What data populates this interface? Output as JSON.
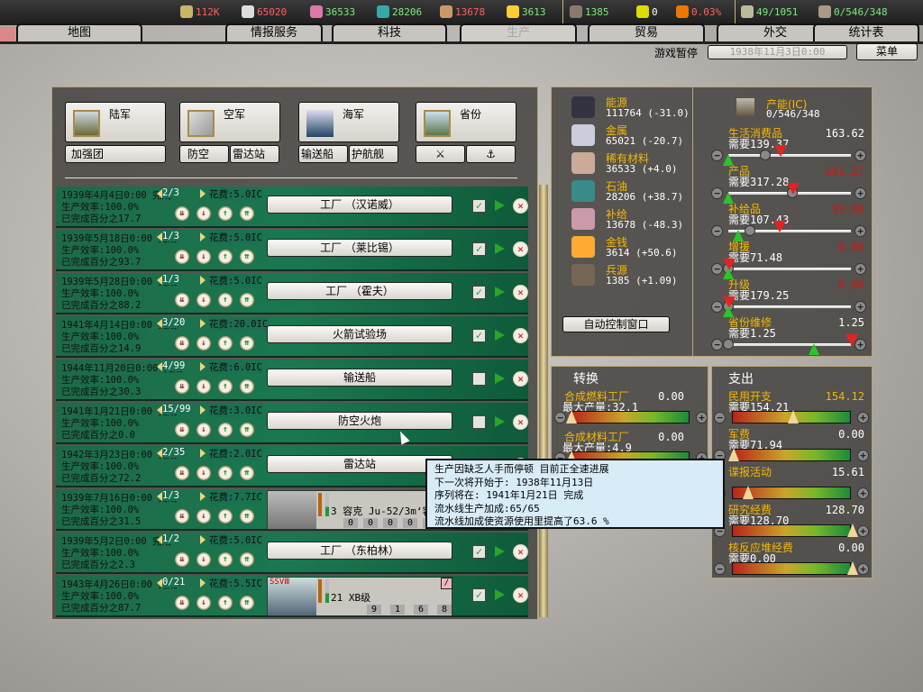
{
  "topbar": {
    "resources": [
      {
        "name": "energy",
        "value": "112K",
        "color": "#ff6060"
      },
      {
        "name": "metal",
        "value": "65020",
        "color": "#ff6060"
      },
      {
        "name": "rare",
        "value": "36533",
        "color": "#7de87d"
      },
      {
        "name": "oil",
        "value": "28206",
        "color": "#7de87d"
      },
      {
        "name": "supplies",
        "value": "13678",
        "color": "#ff6060"
      },
      {
        "name": "money",
        "value": "3613",
        "color": "#7de87d"
      }
    ],
    "manpower": "1385",
    "nuclear": "0",
    "dissent": "0.03%",
    "transports": "49/1051",
    "ic": "0/546/348"
  },
  "tabs": [
    "地图",
    "情报服务",
    "科技",
    "生产",
    "贸易",
    "外交",
    "统计表"
  ],
  "status": {
    "paused": "游戏暂停",
    "date": "1938年11月3日0:00",
    "menu": "菜单"
  },
  "categories": {
    "army": "陆军",
    "air": "空军",
    "navy": "海军",
    "province": "省份",
    "brigade": "加强团",
    "aa": "防空",
    "radar": "雷达站",
    "transport": "输送船",
    "escort": "护航舰",
    "fort_icon": "⚔",
    "port_icon": "⚓"
  },
  "queue": [
    {
      "date": "1939年4月4日0:00 完成",
      "count": "2/3",
      "cost": "花费:5.0IC",
      "eff": "生产效率:100.0%",
      "pct": "已完成百分之17.7",
      "name": "工厂  （汉诺威）",
      "checked": true
    },
    {
      "date": "1939年5月18日0:00 完成",
      "count": "1/3",
      "cost": "花费:5.0IC",
      "eff": "生产效率:100.0%",
      "pct": "已完成百分之93.7",
      "name": "工厂  （莱比锡）",
      "checked": true
    },
    {
      "date": "1939年5月28日0:00 完成",
      "count": "1/3",
      "cost": "花费:5.0IC",
      "eff": "生产效率:100.0%",
      "pct": "已完成百分之88.2",
      "name": "工厂  （霍夫）",
      "checked": true
    },
    {
      "date": "1941年4月14日0:00 完成",
      "count": "3/20",
      "cost": "花费:20.0IC",
      "eff": "生产效率:100.0%",
      "pct": "已完成百分之14.9",
      "name": "火箭试验场",
      "checked": true
    },
    {
      "date": "1944年11月20日0:00 完成",
      "count": "4/99",
      "cost": "花费:6.0IC",
      "eff": "生产效率:100.0%",
      "pct": "已完成百分之30.3",
      "name": "输送船",
      "checked": false
    },
    {
      "date": "1941年1月21日0:00 完成",
      "count": "15/99",
      "cost": "花费:3.0IC",
      "eff": "生产效率:100.0%",
      "pct": "已完成百分之0.0",
      "name": "防空火炮",
      "checked": false
    },
    {
      "date": "1942年3月23日0:00 完成",
      "count": "2/35",
      "cost": "花费:2.0IC",
      "eff": "生产效率:100.0%",
      "pct": "已完成百分之72.2",
      "name": "雷达站",
      "checked": false
    },
    {
      "date": "1939年7月16日0:00 完成",
      "count": "1/3",
      "cost": "花费:7.7IC",
      "eff": "生产效率:100.0%",
      "pct": "已完成百分之31.5",
      "unit": "3 容克 Ju-52/3m‘容",
      "stats": [
        "0",
        "0",
        "0",
        "0",
        "0"
      ],
      "checked": false
    },
    {
      "date": "1939年5月2日0:00 完成",
      "count": "1/2",
      "cost": "花费:5.0IC",
      "eff": "生产效率:100.0%",
      "pct": "已完成百分之2.3",
      "name": "工厂  （东柏林）",
      "checked": true
    },
    {
      "date": "1943年4月26日0:00 完成",
      "count": "0/21",
      "cost": "花费:5.5IC",
      "eff": "生产效率:100.0%",
      "pct": "已完成百分之87.7",
      "unit": "21 XB级",
      "badge": "SSVⅢ",
      "stats": [
        "9",
        "1",
        "6",
        "8"
      ],
      "checked": true
    }
  ],
  "resources": [
    {
      "name": "能源",
      "value": "111764 (-31.0)"
    },
    {
      "name": "金属",
      "value": "65021 (-20.7)"
    },
    {
      "name": "稀有材料",
      "value": "36533 (+4.0)"
    },
    {
      "name": "石油",
      "value": "28206 (+38.7)"
    },
    {
      "name": "补给",
      "value": "13678 (-48.3)"
    },
    {
      "name": "金钱",
      "value": "3614 (+50.6)"
    },
    {
      "name": "兵源",
      "value": "1385 (+1.09)"
    }
  ],
  "auto_button": "自动控制窗口",
  "ic": {
    "title": "产能(IC)",
    "value": "0/546/348"
  },
  "sliders": [
    {
      "name": "生活消费品",
      "need": "需要139.37",
      "value": "163.62",
      "red": false,
      "need_frac": 0.42,
      "set_frac": 0.3,
      "min_frac": 0.0
    },
    {
      "name": "产品",
      "need": "需要317.28",
      "value": "281.27",
      "red": true,
      "need_frac": 0.52,
      "set_frac": 0.52,
      "min_frac": 0.0
    },
    {
      "name": "补给品",
      "need": "需要107.43",
      "value": "99.88",
      "red": true,
      "need_frac": 0.41,
      "set_frac": 0.18,
      "min_frac": 0.08
    },
    {
      "name": "增援",
      "need": "需要71.48",
      "value": "0.00",
      "red": true,
      "need_frac": 0.0,
      "set_frac": 0.0,
      "min_frac": 0.0
    },
    {
      "name": "升级",
      "need": "需要179.25",
      "value": "0.00",
      "red": true,
      "need_frac": 0.0,
      "set_frac": 0.0,
      "min_frac": 0.0
    },
    {
      "name": "省份维修",
      "need": "需要1.25",
      "value": "1.25",
      "red": false,
      "need_frac": 1.0,
      "set_frac": 0.0,
      "min_frac": 0.7
    }
  ],
  "conversion": {
    "title": "转换",
    "items": [
      {
        "name": "合成燃料工厂",
        "max": "最大产量:32.1",
        "value": "0.00",
        "frac": 0.0
      },
      {
        "name": "合成材料工厂",
        "max": "最大产量:4.9",
        "value": "0.00",
        "frac": 0.0
      }
    ]
  },
  "spending": {
    "title": "支出",
    "items": [
      {
        "name": "民用开支",
        "need": "需要154.21",
        "value": "154.12",
        "orange": true,
        "frac": 0.5
      },
      {
        "name": "军费",
        "need": "需要71.94",
        "value": "0.00",
        "frac": 0.0
      },
      {
        "name": "谍报活动",
        "need": "",
        "value": "15.61",
        "frac": 0.12
      },
      {
        "name": "研究经费",
        "need": "需要128.70",
        "value": "128.70",
        "frac": 1.0
      },
      {
        "name": "核反应堆经费",
        "need": "需要0.00",
        "value": "0.00",
        "frac": 1.0
      }
    ]
  },
  "tooltip": [
    "生产因缺乏人手而停顿 目前正全速进展",
    "下一次将开始于: 1938年11月13日",
    " 序列将在: 1941年1月21日 完成",
    "流水线生产加成:65/65",
    "流水线加成使资源使用里提高了63.6 %"
  ]
}
